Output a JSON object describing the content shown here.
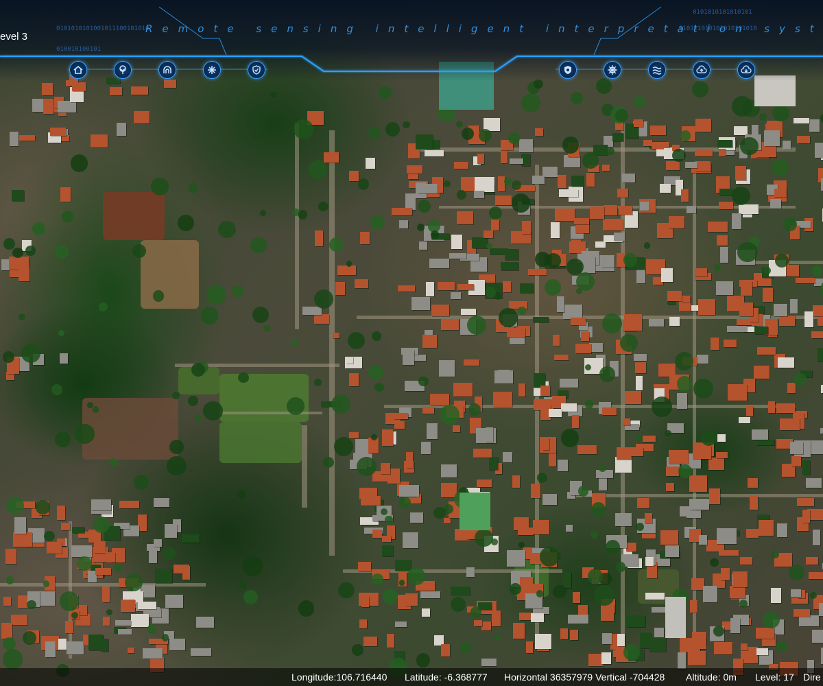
{
  "header": {
    "title": "Remote sensing intelligent interpretation system",
    "binary_left": "0101010101001011100101010",
    "binary_left_bottom": "010010100101",
    "binary_right": "010111010101010101010",
    "binary_right_top": "0101010101010101",
    "level_label": "evel 3"
  },
  "toolbar": {
    "left_icons": [
      "home-icon",
      "tree-icon",
      "tunnel-icon",
      "snowflake-icon",
      "shield-check-icon"
    ],
    "right_icons": [
      "badge-icon",
      "ship-wheel-icon",
      "water-waves-icon",
      "cloud-upload-icon",
      "cloud-download-icon"
    ]
  },
  "status": {
    "longitude": "Longitude:106.716440",
    "latitude": "Latitude: -6.368777",
    "horizontal": "Horizontal 36357979 Vertical -704428",
    "altitude": "Altitude: 0m",
    "level": "Level: 17",
    "direction": "Dire"
  },
  "colors": {
    "frame_line": "#2aa0ff",
    "title": "#2f8fe0",
    "icon_border": "#3aa0ff",
    "roof_orange": "#b5532e",
    "roof_grey": "#8e8c86",
    "vegetation": "#1e4a1c"
  }
}
